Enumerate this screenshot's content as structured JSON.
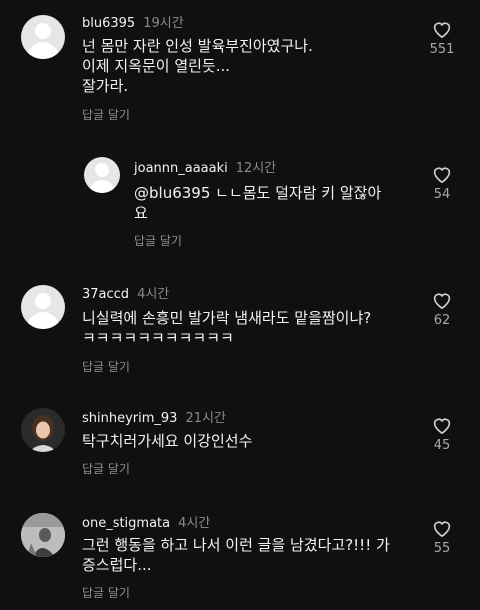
{
  "comments": [
    {
      "user": "blu6395",
      "time": "19시간",
      "text": "넌 몸만 자란 인성 발육부진아였구나.\n이제 지옥문이 열린듯...\n잘가라.",
      "reply": "답글 달기",
      "likes": "551"
    },
    {
      "user": "joannn_aaaaki",
      "time": "12시간",
      "text": "@blu6395 ㄴㄴ몸도 덜자람 키 알잖아\n요",
      "reply": "답글 달기",
      "likes": "54"
    },
    {
      "user": "37accd",
      "time": "4시간",
      "text": "니실력에 손흥민 발가락 냄새라도 맡을짬이냐?\nㅋㅋㅋㅋㅋㅋㅋㅋㅋㅋㅋ",
      "reply": "답글 달기",
      "likes": "62"
    },
    {
      "user": "shinheyrim_93",
      "time": "21시간",
      "text": "탁구치러가세요 이강인선수",
      "reply": "답글 달기",
      "likes": "45"
    },
    {
      "user": "one_stigmata",
      "time": "4시간",
      "text": "그런 행동을 하고 나서 이런 글을 남겼다고?!!! 가\n증스럽다...",
      "reply": "답글 달기",
      "likes": "55"
    }
  ]
}
